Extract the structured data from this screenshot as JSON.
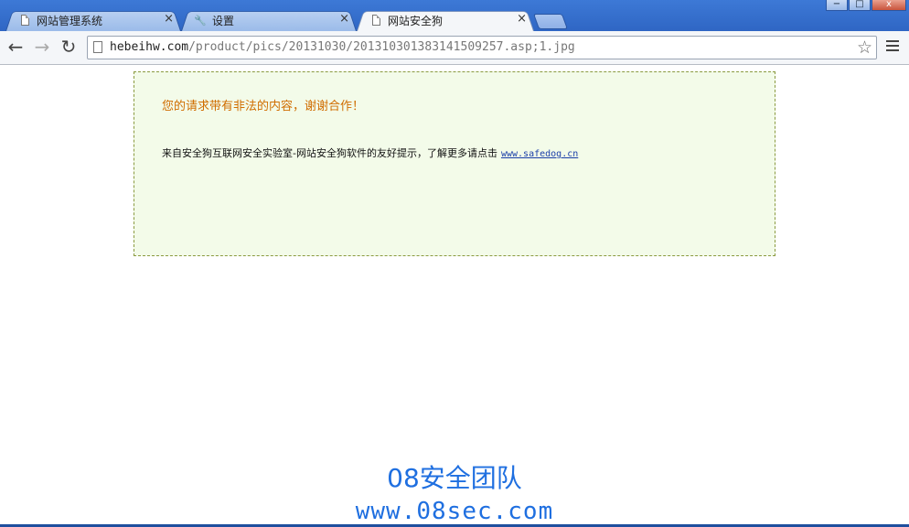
{
  "browser": {
    "tabs": [
      {
        "label": "网站管理系统",
        "icon": "page-icon",
        "active": false
      },
      {
        "label": "设置",
        "icon": "wrench-icon",
        "active": false
      },
      {
        "label": "网站安全狗",
        "icon": "page-icon",
        "active": true
      }
    ],
    "tab_close_glyph": "×",
    "window_controls": [
      "−",
      "□",
      "x"
    ],
    "url_host": "hebeihw.com",
    "url_path": "/product/pics/20131030/201310301383141509257.asp;1.jpg",
    "back_glyph": "←",
    "forward_glyph": "→",
    "reload_glyph": "↻",
    "star_glyph": "☆"
  },
  "notice": {
    "warning": "您的请求带有非法的内容，谢谢合作！",
    "info_text": "来自安全狗互联网安全实验室-网站安全狗软件的友好提示，了解更多请点击",
    "link_text": "www.safedog.cn"
  },
  "watermark": {
    "line1": "08安全团队",
    "line2": "www.08sec.com"
  },
  "colors": {
    "tabstrip": "#3d79d6",
    "notice_bg": "#f3fbe9",
    "warning_text": "#d06d00",
    "watermark": "#1f6fe0"
  }
}
